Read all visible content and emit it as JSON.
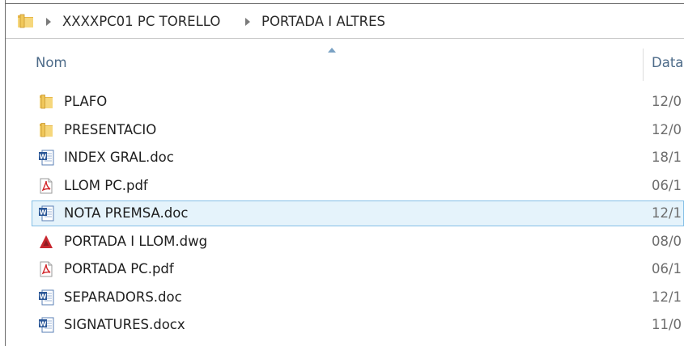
{
  "breadcrumb": {
    "items": [
      "XXXXPC01 PC TORELLO",
      "PORTADA I ALTRES"
    ]
  },
  "columns": {
    "name": "Nom",
    "date": "Data"
  },
  "files": [
    {
      "name": "PLAFO",
      "type": "folder",
      "date": "12/0"
    },
    {
      "name": "PRESENTACIO",
      "type": "folder",
      "date": "12/0"
    },
    {
      "name": "INDEX GRAL.doc",
      "type": "word",
      "date": "18/1"
    },
    {
      "name": "LLOM PC.pdf",
      "type": "pdf",
      "date": "06/1"
    },
    {
      "name": "NOTA PREMSA.doc",
      "type": "word",
      "date": "12/1",
      "selected": true
    },
    {
      "name": "PORTADA I LLOM.dwg",
      "type": "dwg",
      "date": "08/0"
    },
    {
      "name": "PORTADA PC.pdf",
      "type": "pdf",
      "date": "06/1"
    },
    {
      "name": "SEPARADORS.doc",
      "type": "word",
      "date": "12/1"
    },
    {
      "name": "SIGNATURES.docx",
      "type": "word",
      "date": "11/0"
    }
  ],
  "colors": {
    "selection_bg": "#e5f3fb",
    "selection_border": "#84bfe6",
    "header_text": "#4c6a88"
  }
}
